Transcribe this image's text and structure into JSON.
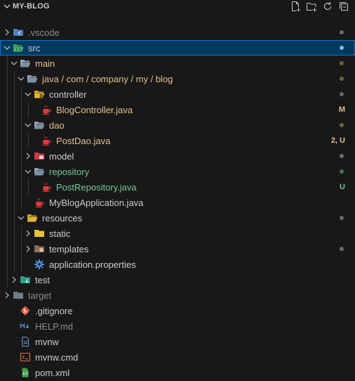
{
  "explorer": {
    "title": "MY-BLOG",
    "actions": [
      {
        "name": "new-file-icon"
      },
      {
        "name": "new-folder-icon"
      },
      {
        "name": "refresh-icon"
      },
      {
        "name": "collapse-all-icon"
      }
    ]
  },
  "tree": [
    {
      "id": "vscode",
      "label": ".vscode",
      "depth": 0,
      "type": "folder",
      "expanded": false,
      "icon": "vscode-folder-icon",
      "status": "dim",
      "dot": "#6b6b6b"
    },
    {
      "id": "src",
      "label": "src",
      "depth": 0,
      "type": "folder",
      "expanded": true,
      "icon": "src-folder-icon",
      "status": "selected",
      "dot": "#8ab4e8"
    },
    {
      "id": "main",
      "label": "main",
      "depth": 1,
      "type": "folder",
      "expanded": true,
      "icon": "folder-open-icon",
      "status": "mod",
      "dot": "#6e6430"
    },
    {
      "id": "java",
      "label": "java / com / company / my / blog",
      "depth": 2,
      "type": "folder",
      "expanded": true,
      "icon": "folder-open-icon",
      "status": "mod",
      "dot": "#6e6430"
    },
    {
      "id": "controller",
      "label": "controller",
      "depth": 3,
      "type": "folder",
      "expanded": true,
      "icon": "controller-folder-icon",
      "status": "def",
      "dot": "#6b6b6b"
    },
    {
      "id": "blogcontroller",
      "label": "BlogController.java",
      "depth": 4,
      "type": "file",
      "icon": "java-file-icon",
      "status": "mod",
      "badge": "M"
    },
    {
      "id": "dao",
      "label": "dao",
      "depth": 3,
      "type": "folder",
      "expanded": true,
      "icon": "folder-open-icon",
      "status": "mod",
      "dot": "#6e6430"
    },
    {
      "id": "postdao",
      "label": "PostDao.java",
      "depth": 4,
      "type": "file",
      "icon": "java-file-icon",
      "status": "mod",
      "badge": "2, U"
    },
    {
      "id": "model",
      "label": "model",
      "depth": 3,
      "type": "folder",
      "expanded": false,
      "icon": "model-folder-icon",
      "status": "def",
      "dot": "#6b6b6b"
    },
    {
      "id": "repository",
      "label": "repository",
      "depth": 3,
      "type": "folder",
      "expanded": true,
      "icon": "folder-open-icon",
      "status": "add",
      "dot": "#3f7a52"
    },
    {
      "id": "postrepository",
      "label": "PostRepository.java",
      "depth": 4,
      "type": "file",
      "icon": "java-file-icon",
      "status": "add",
      "badge": "U"
    },
    {
      "id": "mybloggapp",
      "label": "MyBlogApplication.java",
      "depth": 3,
      "type": "file",
      "icon": "java-file-icon",
      "status": "def"
    },
    {
      "id": "resources",
      "label": "resources",
      "depth": 2,
      "type": "folder",
      "expanded": true,
      "icon": "resources-folder-icon",
      "status": "def",
      "dot": "#6b6b6b"
    },
    {
      "id": "static",
      "label": "static",
      "depth": 3,
      "type": "folder",
      "expanded": false,
      "icon": "static-folder-icon",
      "status": "def"
    },
    {
      "id": "templates",
      "label": "templates",
      "depth": 3,
      "type": "folder",
      "expanded": false,
      "icon": "templates-folder-icon",
      "status": "def",
      "dot": "#6b6b6b"
    },
    {
      "id": "appprops",
      "label": "application.properties",
      "depth": 3,
      "type": "file",
      "icon": "gear-icon",
      "status": "def"
    },
    {
      "id": "test",
      "label": "test",
      "depth": 1,
      "type": "folder",
      "expanded": false,
      "icon": "test-folder-icon",
      "status": "def"
    },
    {
      "id": "target",
      "label": "target",
      "depth": 0,
      "type": "folder",
      "expanded": false,
      "icon": "target-folder-icon",
      "status": "dim"
    },
    {
      "id": "gitignore",
      "label": ".gitignore",
      "depth": 1,
      "type": "file",
      "icon": "git-icon",
      "status": "def"
    },
    {
      "id": "helpmd",
      "label": "HELP.md",
      "depth": 1,
      "type": "file",
      "icon": "markdown-icon",
      "status": "dim"
    },
    {
      "id": "mvnw",
      "label": "mvnw",
      "depth": 1,
      "type": "file",
      "icon": "file-icon",
      "status": "def"
    },
    {
      "id": "mvnwcmd",
      "label": "mvnw.cmd",
      "depth": 1,
      "type": "file",
      "icon": "terminal-icon",
      "status": "def"
    },
    {
      "id": "pomxml",
      "label": "pom.xml",
      "depth": 1,
      "type": "file",
      "icon": "xml-file-icon",
      "status": "def"
    }
  ]
}
